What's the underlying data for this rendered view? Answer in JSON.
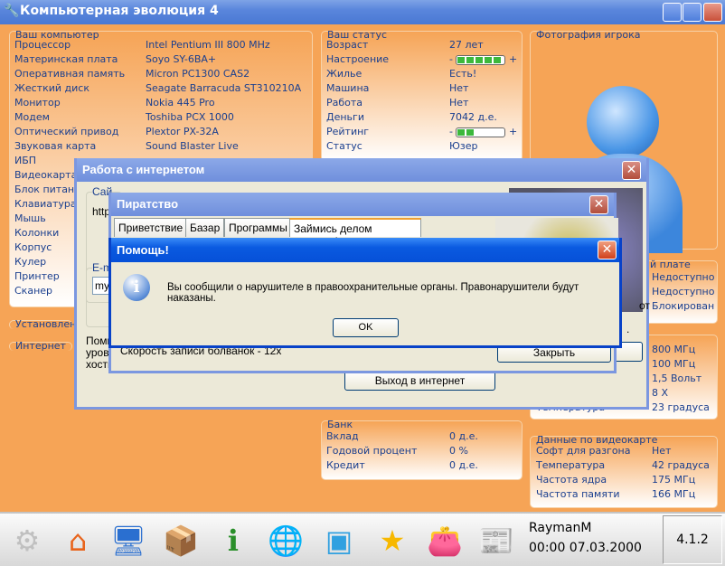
{
  "app": {
    "title": "Компьютерная эволюция 4"
  },
  "computer": {
    "title": "Ваш компьютер",
    "rows": [
      {
        "label": "Процессор",
        "value": "Intel Pentium III 800 MHz"
      },
      {
        "label": "Материнская плата",
        "value": "Soyo SY-6BA+"
      },
      {
        "label": "Оперативная память",
        "value": "Micron PC1300 CAS2"
      },
      {
        "label": "Жесткий диск",
        "value": "Seagate Barracuda ST310210A"
      },
      {
        "label": "Монитор",
        "value": "Nokia 445 Pro"
      },
      {
        "label": "Модем",
        "value": "Toshiba PCX 1000"
      },
      {
        "label": "Оптический привод",
        "value": "Plextor PX-32A"
      },
      {
        "label": "Звуковая карта",
        "value": "Sound Blaster Live"
      },
      {
        "label": "ИБП",
        "value": ""
      },
      {
        "label": "Видеокарта",
        "value": ""
      },
      {
        "label": "Блок питани",
        "value": ""
      },
      {
        "label": "Клавиатура",
        "value": ""
      },
      {
        "label": "Мышь",
        "value": ""
      },
      {
        "label": "Колонки",
        "value": ""
      },
      {
        "label": "Корпус",
        "value": ""
      },
      {
        "label": "Кулер",
        "value": ""
      },
      {
        "label": "Принтер",
        "value": ""
      },
      {
        "label": "Сканер",
        "value": ""
      }
    ],
    "installed_label": "Установленн",
    "internet_label": "Интернет"
  },
  "status": {
    "title": "Ваш статус",
    "rows": [
      {
        "label": "Возраст",
        "value": "27 лет"
      },
      {
        "label": "Настроение",
        "value": "",
        "bar": 5
      },
      {
        "label": "Жилье",
        "value": "Есть!"
      },
      {
        "label": "Машина",
        "value": "Нет"
      },
      {
        "label": "Работа",
        "value": "Нет"
      },
      {
        "label": "Деньги",
        "value": "7042 д.е."
      },
      {
        "label": "Рейтинг",
        "value": "",
        "bar": 2
      },
      {
        "label": "Статус",
        "value": "Юзер"
      }
    ],
    "minus": "-",
    "plus": "+"
  },
  "photo": {
    "title": "Фотография игрока"
  },
  "mobo": {
    "title": "й плате",
    "values": [
      "Недоступно",
      "Недоступно",
      "Блокирован"
    ]
  },
  "cpu": {
    "values": [
      "800 МГц",
      "100 МГц",
      "1,5 Вольт",
      "8 X",
      "23 градуса"
    ],
    "last_label": "Температура"
  },
  "bank": {
    "title": "Банк",
    "rows": [
      {
        "label": "Вклад",
        "value": "0 д.е."
      },
      {
        "label": "Годовой процент",
        "value": "0 %"
      },
      {
        "label": "Кредит",
        "value": "0 д.е."
      }
    ]
  },
  "video": {
    "title": "Данные по видеокарте",
    "rows": [
      {
        "label": "Софт для разгона",
        "value": "Нет"
      },
      {
        "label": "Температура",
        "value": "42 градуса"
      },
      {
        "label": "Частота ядра",
        "value": "175 МГц"
      },
      {
        "label": "Частота памяти",
        "value": "166 МГц"
      }
    ]
  },
  "internet_window": {
    "title": "Работа с интернетом",
    "site_label": "Сай",
    "site_value": "http",
    "email_label": "E-m",
    "email_value": "my",
    "note": [
      "Помн",
      "уровн",
      "хости"
    ],
    "exit_button": "Выход в интернет",
    "right_frag1": "от",
    "right_frag2": "."
  },
  "piracy_window": {
    "title": "Пиратство",
    "tabs": [
      "Приветствие",
      "Базар",
      "Программы",
      "Займись делом наконец!"
    ],
    "burn_speed": "Скорость записи болванок - 12x",
    "close_button": "Закрыть"
  },
  "help_dialog": {
    "title": "Помощь!",
    "message": "Вы сообщили о нарушителе в правоохранительные органы. Правонарушители будут наказаны.",
    "ok_button": "OK"
  },
  "taskbar": {
    "user": "RaymanM",
    "datetime": "00:00 07.03.2000",
    "version": "4.1.2",
    "icons": [
      "kde-icon",
      "home-icon",
      "computer-icon",
      "software-box-icon",
      "info-card-icon",
      "web-browser-icon",
      "blocks-icon",
      "star-icon",
      "wallet-icon",
      "newspaper-icon"
    ]
  }
}
